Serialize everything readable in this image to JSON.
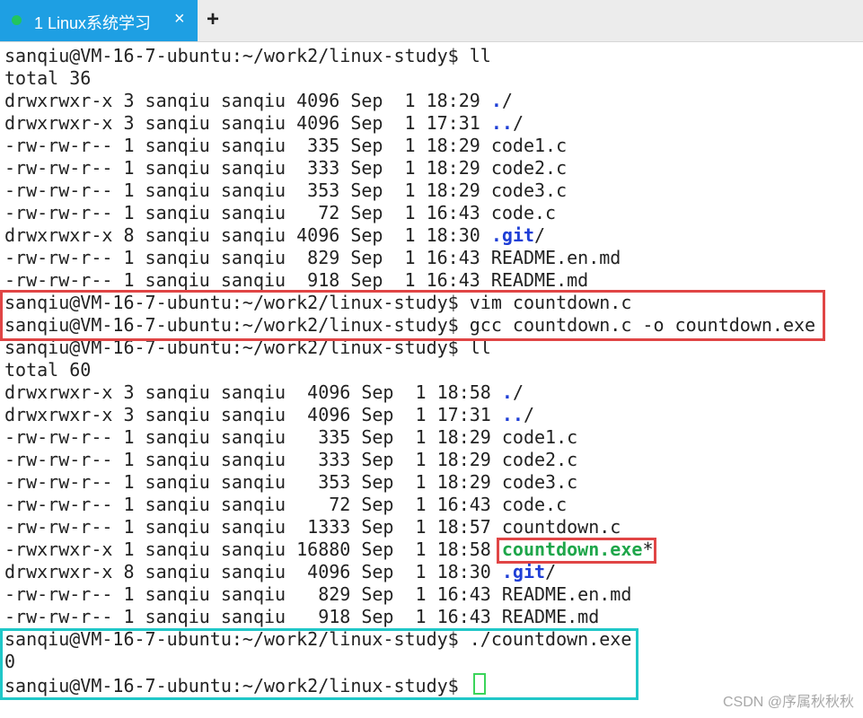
{
  "tab": {
    "title": "1 Linux系统学习",
    "close_icon": "×",
    "add_icon": "+",
    "status_color": "#22c55e",
    "active_color": "#1e9fe3"
  },
  "terminal": {
    "lines": [
      "sanqiu@VM-16-7-ubuntu:~/work2/linux-study$ ll",
      "total 36",
      "drwxrwxr-x 3 sanqiu sanqiu 4096 Sep  1 18:29 ./",
      "drwxrwxr-x 3 sanqiu sanqiu 4096 Sep  1 17:31 ../",
      "-rw-rw-r-- 1 sanqiu sanqiu  335 Sep  1 18:29 code1.c",
      "-rw-rw-r-- 1 sanqiu sanqiu  333 Sep  1 18:29 code2.c",
      "-rw-rw-r-- 1 sanqiu sanqiu  353 Sep  1 18:29 code3.c",
      "-rw-rw-r-- 1 sanqiu sanqiu   72 Sep  1 16:43 code.c",
      "drwxrwxr-x 8 sanqiu sanqiu 4096 Sep  1 18:30 .git/",
      "-rw-rw-r-- 1 sanqiu sanqiu  829 Sep  1 16:43 README.en.md",
      "-rw-rw-r-- 1 sanqiu sanqiu  918 Sep  1 16:43 README.md",
      "sanqiu@VM-16-7-ubuntu:~/work2/linux-study$ vim countdown.c",
      "sanqiu@VM-16-7-ubuntu:~/work2/linux-study$ gcc countdown.c -o countdown.exe",
      "sanqiu@VM-16-7-ubuntu:~/work2/linux-study$ ll",
      "total 60",
      "drwxrwxr-x 3 sanqiu sanqiu  4096 Sep  1 18:58 ./",
      "drwxrwxr-x 3 sanqiu sanqiu  4096 Sep  1 17:31 ../",
      "-rw-rw-r-- 1 sanqiu sanqiu   335 Sep  1 18:29 code1.c",
      "-rw-rw-r-- 1 sanqiu sanqiu   333 Sep  1 18:29 code2.c",
      "-rw-rw-r-- 1 sanqiu sanqiu   353 Sep  1 18:29 code3.c",
      "-rw-rw-r-- 1 sanqiu sanqiu    72 Sep  1 16:43 code.c",
      "-rw-rw-r-- 1 sanqiu sanqiu  1333 Sep  1 18:57 countdown.c",
      "-rwxrwxr-x 1 sanqiu sanqiu 16880 Sep  1 18:58 countdown.exe*",
      "drwxrwxr-x 8 sanqiu sanqiu  4096 Sep  1 18:30 .git/",
      "-rw-rw-r-- 1 sanqiu sanqiu   829 Sep  1 16:43 README.en.md",
      "-rw-rw-r-- 1 sanqiu sanqiu   918 Sep  1 16:43 README.md",
      "sanqiu@VM-16-7-ubuntu:~/work2/linux-study$ ./countdown.exe",
      "0",
      "sanqiu@VM-16-7-ubuntu:~/work2/linux-study$ "
    ],
    "colors": {
      "directory": "#1f3fd6",
      "executable": "#1fa64a",
      "highlight_red": "#e04545",
      "highlight_cyan": "#20c7c8"
    }
  },
  "watermark": "CSDN @序属秋秋秋"
}
